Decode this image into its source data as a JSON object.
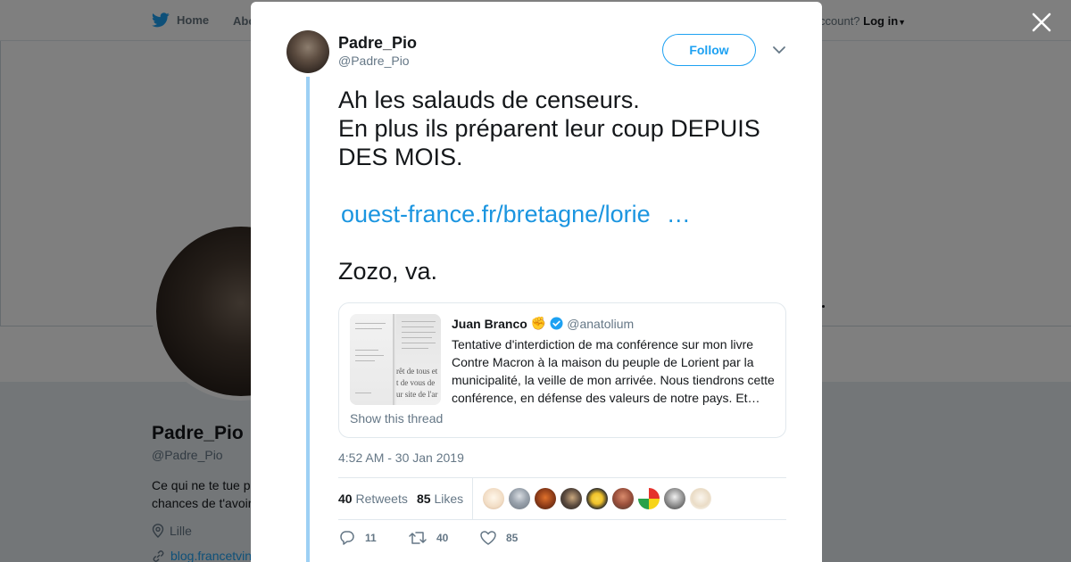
{
  "background": {
    "nav": {
      "home_label": "Home",
      "about_label": "Abo",
      "account_prompt": "ccount?",
      "login_label": "Log in"
    },
    "profile": {
      "name": "Padre_Pio",
      "handle": "@Padre_Pio",
      "bio_line1": "Ce qui ne te tue p",
      "bio_line2": "chances de t'avoir",
      "location": "Lille",
      "website": "blog.francetvin"
    }
  },
  "tweet": {
    "author_name": "Padre_Pio",
    "author_handle": "@Padre_Pio",
    "follow_label": "Follow",
    "text_line1": "Ah les salauds de censeurs.",
    "text_line2": "En plus ils préparent leur coup DEPUIS DES MOIS.",
    "link_text": "ouest-france.fr/bretagne/lorie",
    "link_ellipsis": "…",
    "text_tail": "Zozo, va.",
    "timestamp": "4:52 AM - 30 Jan 2019",
    "quoted": {
      "name": "Juan Branco",
      "emoji": "✊",
      "handle": "@anatolium",
      "text": "Tentative d'interdiction de ma conférence sur mon livre Contre Macron à la maison du peuple de Lorient par la municipalité, la veille de mon arrivée. Nous tiendrons cette conférence, en défense des valeurs de notre pays. Et…",
      "thumb_text_1": "rêt de tous et",
      "thumb_text_2": "t de vous de",
      "thumb_text_3": "ur site de l'ar",
      "show_thread": "Show this thread"
    },
    "stats": {
      "retweets_count": "40",
      "retweets_label": "Retweets",
      "likes_count": "85",
      "likes_label": "Likes"
    },
    "actions": {
      "replies": "11",
      "retweets": "40",
      "likes": "85"
    }
  },
  "colors": {
    "accent": "#1da1f2",
    "thread_line": "#9dd0f4",
    "muted": "#657786",
    "verified": "#1da1f2"
  }
}
